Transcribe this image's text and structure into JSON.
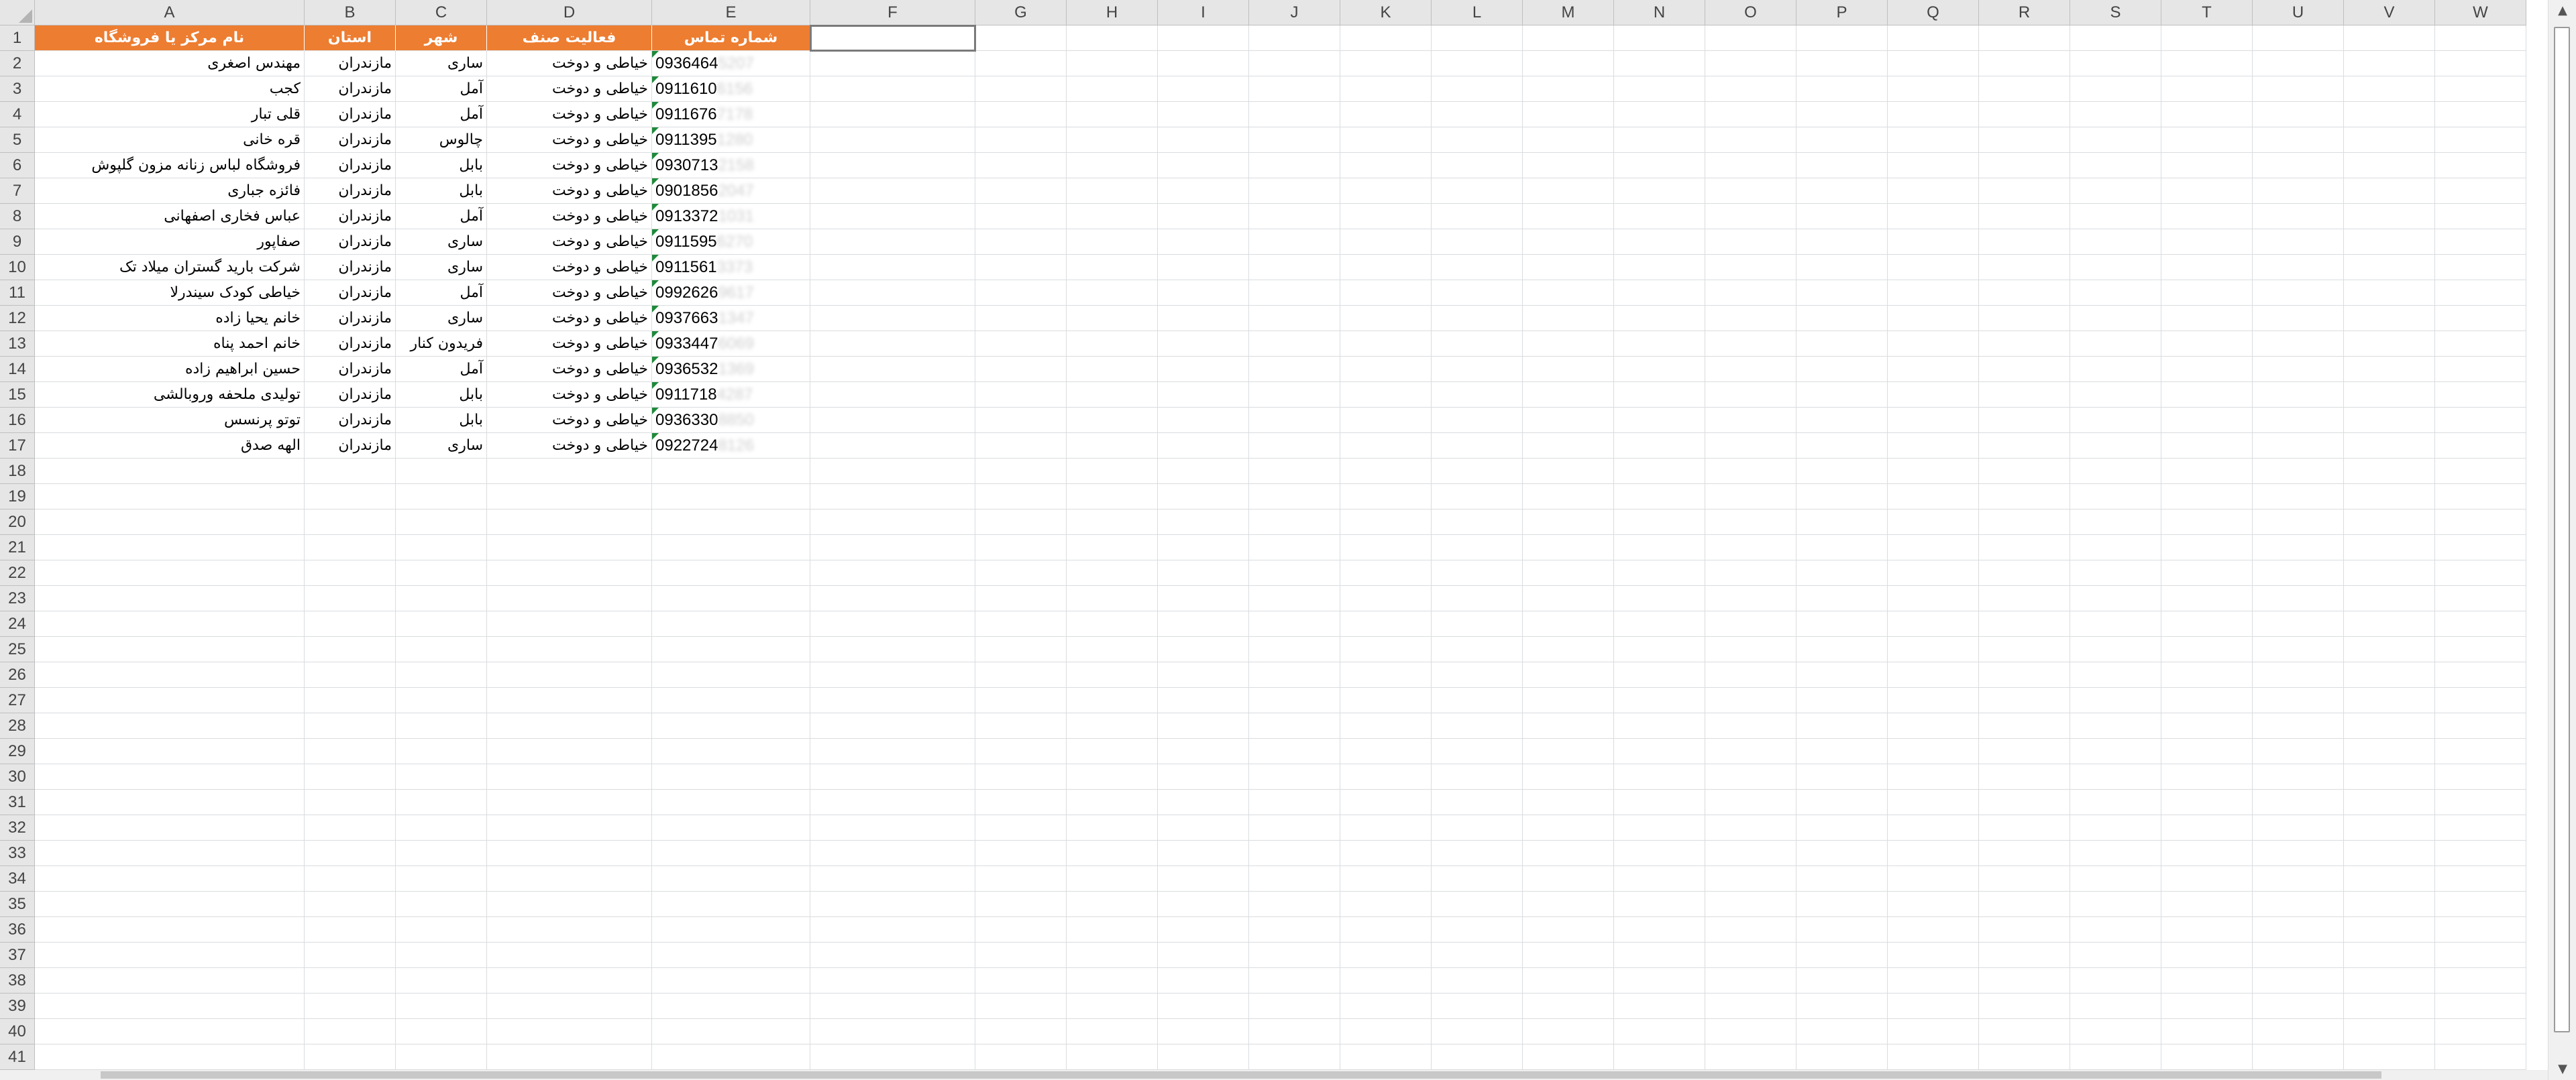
{
  "columns": [
    "A",
    "B",
    "C",
    "D",
    "E",
    "F",
    "G",
    "H",
    "I",
    "J",
    "K",
    "L",
    "M",
    "N",
    "O",
    "P",
    "Q",
    "R",
    "S",
    "T",
    "U",
    "V",
    "W"
  ],
  "header_row": {
    "A": "نام مرکز یا فروشگاه",
    "B": "استان",
    "C": "شهر",
    "D": "فعالیت صنف",
    "E": "شماره تماس"
  },
  "rows": [
    {
      "name": "مهندس اصغری",
      "province": "مازندران",
      "city": "ساری",
      "activity": "خیاطی و دوخت",
      "phone": "0936464",
      "phone_hidden": "5207"
    },
    {
      "name": "کجب",
      "province": "مازندران",
      "city": "آمل",
      "activity": "خیاطی و دوخت",
      "phone": "0911610",
      "phone_hidden": "6156"
    },
    {
      "name": "قلی تبار",
      "province": "مازندران",
      "city": "آمل",
      "activity": "خیاطی و دوخت",
      "phone": "0911676",
      "phone_hidden": "7178"
    },
    {
      "name": "قره خانی",
      "province": "مازندران",
      "city": "چالوس",
      "activity": "خیاطی و دوخت",
      "phone": "0911395",
      "phone_hidden": "1280"
    },
    {
      "name": "فروشگاه لباس زنانه مزون گلپوش",
      "province": "مازندران",
      "city": "بابل",
      "activity": "خیاطی و دوخت",
      "phone": "0930713",
      "phone_hidden": "2158"
    },
    {
      "name": "فائزه جباری",
      "province": "مازندران",
      "city": "بابل",
      "activity": "خیاطی و دوخت",
      "phone": "0901856",
      "phone_hidden": "2047"
    },
    {
      "name": "عباس فخاری اصفهانی",
      "province": "مازندران",
      "city": "آمل",
      "activity": "خیاطی و دوخت",
      "phone": "0913372",
      "phone_hidden": "1031"
    },
    {
      "name": "صفاپور",
      "province": "مازندران",
      "city": "ساری",
      "activity": "خیاطی و دوخت",
      "phone": "0911595",
      "phone_hidden": "6270"
    },
    {
      "name": "شرکت بارید گستران میلاد تک",
      "province": "مازندران",
      "city": "ساری",
      "activity": "خیاطی و دوخت",
      "phone": "0911561",
      "phone_hidden": "3373"
    },
    {
      "name": "خیاطی کودک سیندرلا",
      "province": "مازندران",
      "city": "آمل",
      "activity": "خیاطی و دوخت",
      "phone": "0992626",
      "phone_hidden": "9617"
    },
    {
      "name": "خانم یحیا زاده",
      "province": "مازندران",
      "city": "ساری",
      "activity": "خیاطی و دوخت",
      "phone": "0937663",
      "phone_hidden": "1347"
    },
    {
      "name": "خانم احمد پناه",
      "province": "مازندران",
      "city": "فریدون کنار",
      "activity": "خیاطی و دوخت",
      "phone": "0933447",
      "phone_hidden": "6069"
    },
    {
      "name": "حسین ابراهیم زاده",
      "province": "مازندران",
      "city": "آمل",
      "activity": "خیاطی و دوخت",
      "phone": "0936532",
      "phone_hidden": "1369"
    },
    {
      "name": "تولیدی ملحفه وروبالشی",
      "province": "مازندران",
      "city": "بابل",
      "activity": "خیاطی و دوخت",
      "phone": "0911718",
      "phone_hidden": "4287"
    },
    {
      "name": "توتو پرنسس",
      "province": "مازندران",
      "city": "بابل",
      "activity": "خیاطی و دوخت",
      "phone": "0936330",
      "phone_hidden": "8850"
    },
    {
      "name": "الهه صدق",
      "province": "مازندران",
      "city": "ساری",
      "activity": "خیاطی و دوخت",
      "phone": "0922724",
      "phone_hidden": "8126"
    }
  ],
  "colors": {
    "header_fill": "#ed7d31",
    "header_text": "#ffffff",
    "number_as_text_flag": "#1e8a3a",
    "grid": "#dadcdf",
    "heading_bg": "#e6e6e6"
  },
  "row_numbers": [
    "1",
    "2",
    "3",
    "4",
    "5",
    "6",
    "7",
    "8",
    "9",
    "10",
    "11",
    "12",
    "13",
    "14",
    "15",
    "16",
    "17",
    "18",
    "19",
    "20",
    "21",
    "22",
    "23",
    "24",
    "25",
    "26",
    "27",
    "28",
    "29",
    "30",
    "31",
    "32",
    "33",
    "34",
    "35",
    "36",
    "37",
    "38",
    "39",
    "40",
    "41"
  ],
  "icons": {
    "scroll_up": "triangle-up-icon",
    "scroll_down": "triangle-down-icon",
    "select_all": "select-all-corner-icon"
  }
}
